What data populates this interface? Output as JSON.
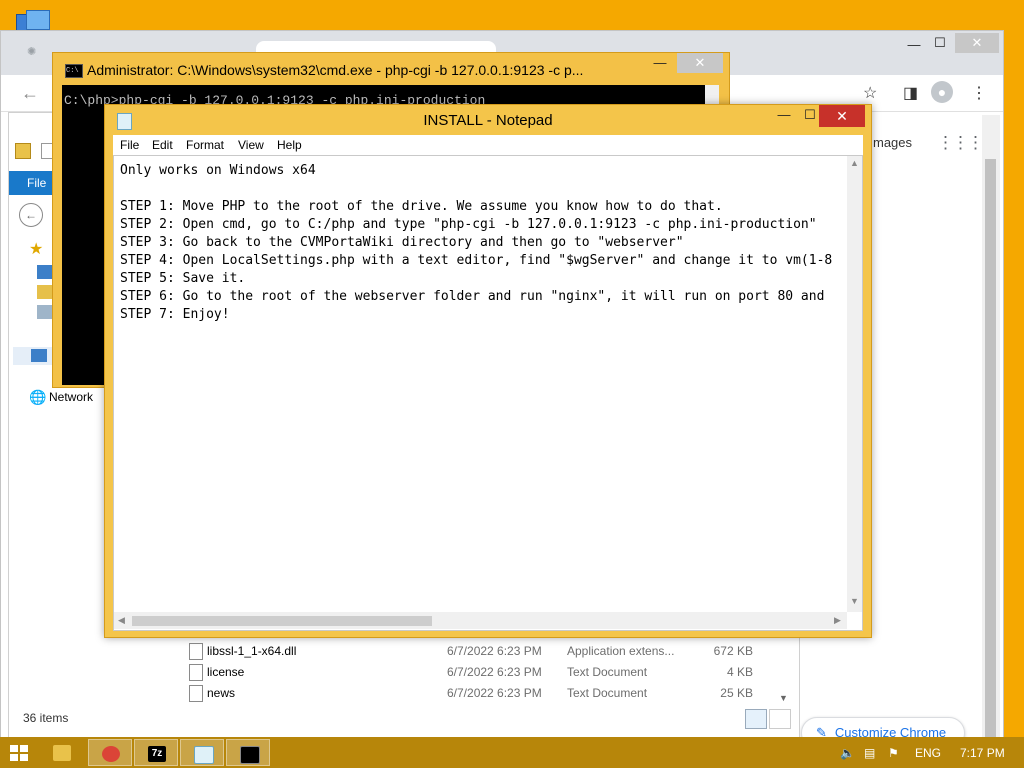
{
  "chrome": {
    "toolbar_icons": [
      "back-icon",
      "star-icon",
      "side-panel-icon",
      "profile-icon",
      "menu-icon"
    ],
    "images_link": "mages",
    "customize_label": "Customize Chrome"
  },
  "explorer": {
    "file_tab": "File",
    "network_label": "Network",
    "files": [
      {
        "name": "libssl-1_1-x64.dll",
        "date": "6/7/2022 6:23 PM",
        "type": "Application extens...",
        "size": "672 KB"
      },
      {
        "name": "license",
        "date": "6/7/2022 6:23 PM",
        "type": "Text Document",
        "size": "4 KB"
      },
      {
        "name": "news",
        "date": "6/7/2022 6:23 PM",
        "type": "Text Document",
        "size": "25 KB"
      }
    ],
    "status": "36 items"
  },
  "cmd": {
    "title": "Administrator: C:\\Windows\\system32\\cmd.exe - php-cgi  -b 127.0.0.1:9123 -c p...",
    "line": "C:\\php>php-cgi -b 127.0.0.1:9123 -c php.ini-production"
  },
  "notepad": {
    "title": "INSTALL - Notepad",
    "menu": [
      "File",
      "Edit",
      "Format",
      "View",
      "Help"
    ],
    "content": "Only works on Windows x64\n\nSTEP 1: Move PHP to the root of the drive. We assume you know how to do that.\nSTEP 2: Open cmd, go to C:/php and type \"php-cgi -b 127.0.0.1:9123 -c php.ini-production\"\nSTEP 3: Go back to the CVMPortaWiki directory and then go to \"webserver\"\nSTEP 4: Open LocalSettings.php with a text editor, find \"$wgServer\" and change it to vm(1-8\nSTEP 5: Save it.\nSTEP 6: Go to the root of the webserver folder and run \"nginx\", it will run on port 80 and\nSTEP 7: Enjoy!"
  },
  "taskbar": {
    "apps": [
      "explorer-icon",
      "chrome-icon",
      "7zip-icon",
      "notepad-icon",
      "cmd-icon"
    ],
    "seven_zip_label": "7z",
    "language": "ENG",
    "time": "7:17 PM"
  }
}
